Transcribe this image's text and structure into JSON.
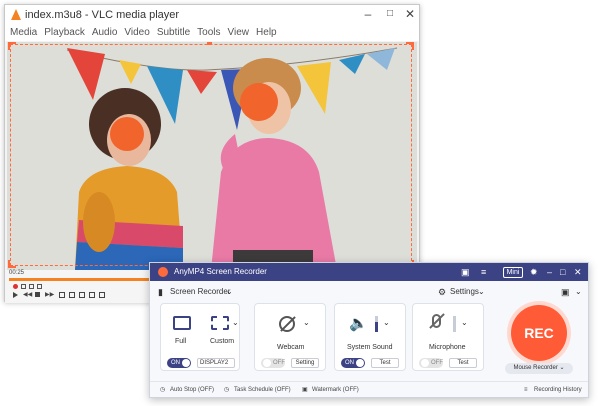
{
  "vlc": {
    "title": "index.m3u8 - VLC media player",
    "menu": [
      "Media",
      "Playback",
      "Audio",
      "Video",
      "Subtitle",
      "Tools",
      "View",
      "Help"
    ],
    "time_elapsed": "00:25",
    "progress_fraction": 0.42
  },
  "recorder": {
    "app_title": "AnyMP4 Screen Recorder",
    "mini_label": "Mini",
    "mode_label": "Screen Recorder",
    "settings_label": "Settings",
    "full_label": "Full",
    "custom_label": "Custom",
    "display_toggle": "ON",
    "display_select": "DISPLAY2",
    "webcam_label": "Webcam",
    "webcam_toggle": "OFF",
    "webcam_setting": "Setting",
    "system_sound_label": "System Sound",
    "system_sound_toggle": "ON",
    "system_sound_test": "Test",
    "microphone_label": "Microphone",
    "microphone_toggle": "OFF",
    "microphone_test": "Test",
    "rec_label": "REC",
    "mouse_recorder_label": "Mouse Recorder",
    "auto_stop": "Auto Stop (OFF)",
    "task_schedule": "Task Schedule (OFF)",
    "watermark": "Watermark (OFF)",
    "recording_history": "Recording History"
  },
  "colors": {
    "vlc_orange": "#f58220",
    "recorder_header": "#3c4385",
    "rec_button": "#ff5b37",
    "selection_border": "#ff6a3d"
  }
}
